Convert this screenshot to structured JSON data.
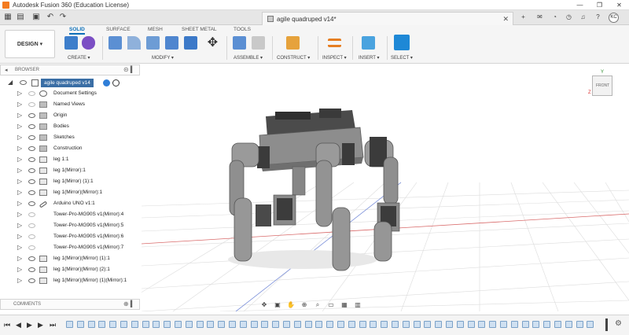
{
  "window": {
    "title": "Autodesk Fusion 360 (Education License)",
    "controls": [
      "—",
      "❐",
      "✕"
    ]
  },
  "document_tab": {
    "title": "agile quadruped v14*",
    "close": "✕"
  },
  "user": {
    "initials": "KC"
  },
  "toolbar": {
    "workspace": "DESIGN ▾",
    "tabs": [
      "SOLID",
      "SURFACE",
      "MESH",
      "SHEET METAL",
      "TOOLS"
    ],
    "active_tab": "SOLID",
    "groups": {
      "create": "CREATE ▾",
      "modify": "MODIFY ▾",
      "assemble": "ASSEMBLE ▾",
      "construct": "CONSTRUCT ▾",
      "inspect": "INSPECT ▾",
      "insert": "INSERT ▾",
      "select": "SELECT ▾"
    }
  },
  "browser": {
    "label": "BROWSER",
    "root": "agile quadruped v14",
    "items": [
      {
        "label": "Document Settings",
        "icon": "gear-icon"
      },
      {
        "label": "Named Views",
        "icon": "folder-icon"
      },
      {
        "label": "Origin",
        "icon": "folder-icon"
      },
      {
        "label": "Bodies",
        "icon": "folder-icon"
      },
      {
        "label": "Sketches",
        "icon": "folder-icon"
      },
      {
        "label": "Construction",
        "icon": "folder-icon"
      },
      {
        "label": "leg 1:1",
        "icon": "component-icon"
      },
      {
        "label": "leg 1(Mirror):1",
        "icon": "component-icon"
      },
      {
        "label": "leg 1(Mirror) (1):1",
        "icon": "component-icon"
      },
      {
        "label": "leg 1(Mirror)(Mirror):1",
        "icon": "component-icon"
      },
      {
        "label": "Arduino UNO v1:1",
        "icon": "link-icon"
      },
      {
        "label": "Tower-Pro-MG90S v1(Mirror):4",
        "icon": "component-icon"
      },
      {
        "label": "Tower-Pro-MG90S v1(Mirror):5",
        "icon": "component-icon"
      },
      {
        "label": "Tower-Pro-MG90S v1(Mirror):6",
        "icon": "component-icon"
      },
      {
        "label": "Tower-Pro-MG90S v1(Mirror):7",
        "icon": "component-icon"
      },
      {
        "label": "leg 1(Mirror)(Mirror) (1):1",
        "icon": "component-icon"
      },
      {
        "label": "leg 1(Mirror)(Mirror) (2):1",
        "icon": "component-icon"
      },
      {
        "label": "leg 1(Mirror)(Mirror) (1)(Mirror):1",
        "icon": "component-icon"
      }
    ]
  },
  "comments": {
    "label": "COMMENTS"
  },
  "viewcube": {
    "face": "FRONT",
    "axis_z": "Z",
    "axis_y": "Y"
  },
  "colors": {
    "accent": "#0d6fb8",
    "selected": "#3a6ea5",
    "model_gray": "#8f8f8f",
    "grid": "#d9d9d9"
  }
}
